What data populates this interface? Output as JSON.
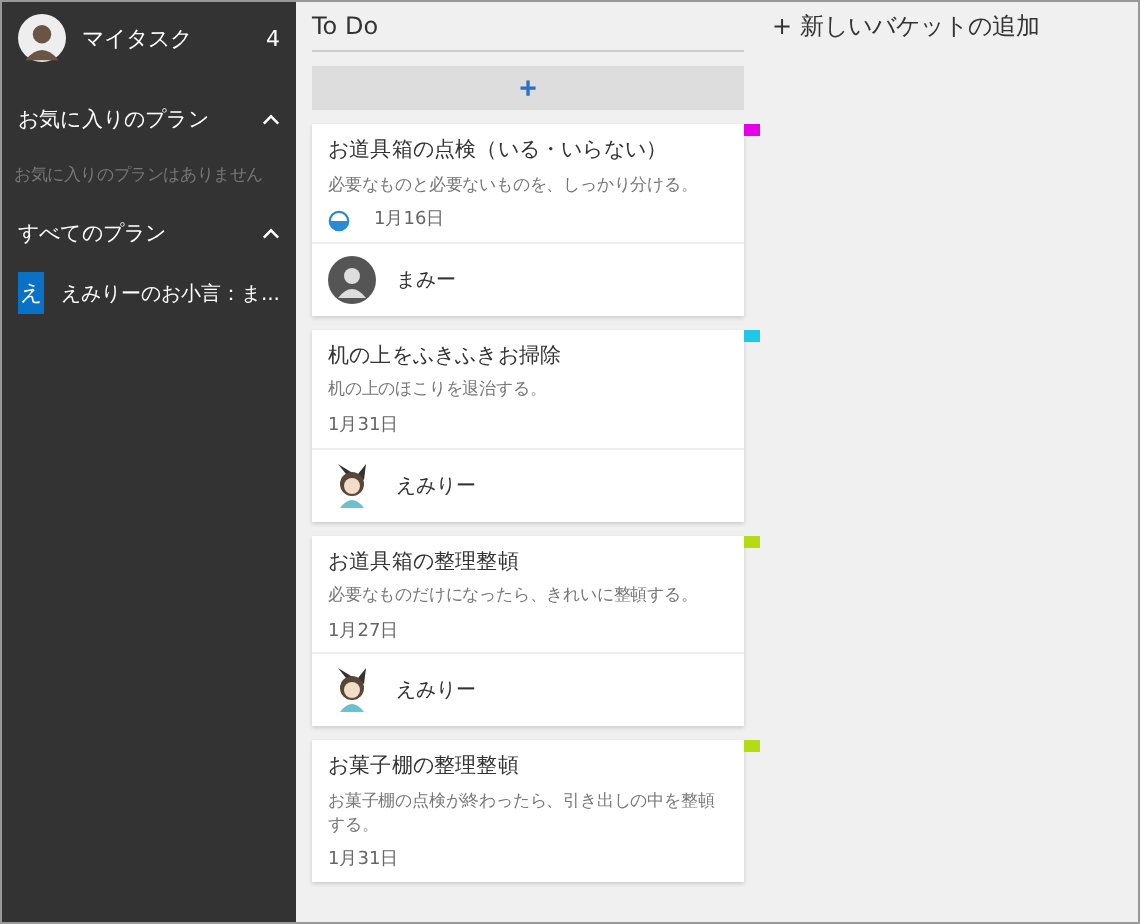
{
  "sidebar": {
    "my_tasks": {
      "label": "マイタスク",
      "count": "4"
    },
    "favorites": {
      "title": "お気に入りのプラン",
      "expanded": true,
      "empty_text": "お気に入りのプランはありません"
    },
    "all_plans": {
      "title": "すべてのプラン",
      "expanded": true,
      "plans": [
        {
          "initial": "え",
          "name": "えみりーのお小言：ま...",
          "selected": true
        }
      ]
    }
  },
  "bucket": {
    "title": "To Do",
    "add_label": "+"
  },
  "cards": [
    {
      "title": "お道具箱の点検（いる・いらない）",
      "description": "必要なものと必要ないものを、しっかり分ける。",
      "in_progress": true,
      "due": "1月16日",
      "assignee": "まみー",
      "avatar": {
        "kind": "photo"
      },
      "color": "#e600e6"
    },
    {
      "title": "机の上をふきふきお掃除",
      "description": "机の上のほこりを退治する。",
      "in_progress": false,
      "due": "1月31日",
      "assignee": "えみりー",
      "avatar": {
        "kind": "character"
      },
      "color": "#1ec8e6"
    },
    {
      "title": "お道具箱の整理整頓",
      "description": "必要なものだけになったら、きれいに整頓する。",
      "in_progress": false,
      "due": "1月27日",
      "assignee": "えみりー",
      "avatar": {
        "kind": "character"
      },
      "color": "#b4dc14"
    },
    {
      "title": "お菓子棚の整理整頓",
      "description": "お菓子棚の点検が終わったら、引き出しの中を整頓する。",
      "in_progress": false,
      "due": "1月31日",
      "color": "#b4dc14"
    }
  ],
  "new_bucket": {
    "label": "新しいバケットの追加",
    "icon": "+"
  }
}
